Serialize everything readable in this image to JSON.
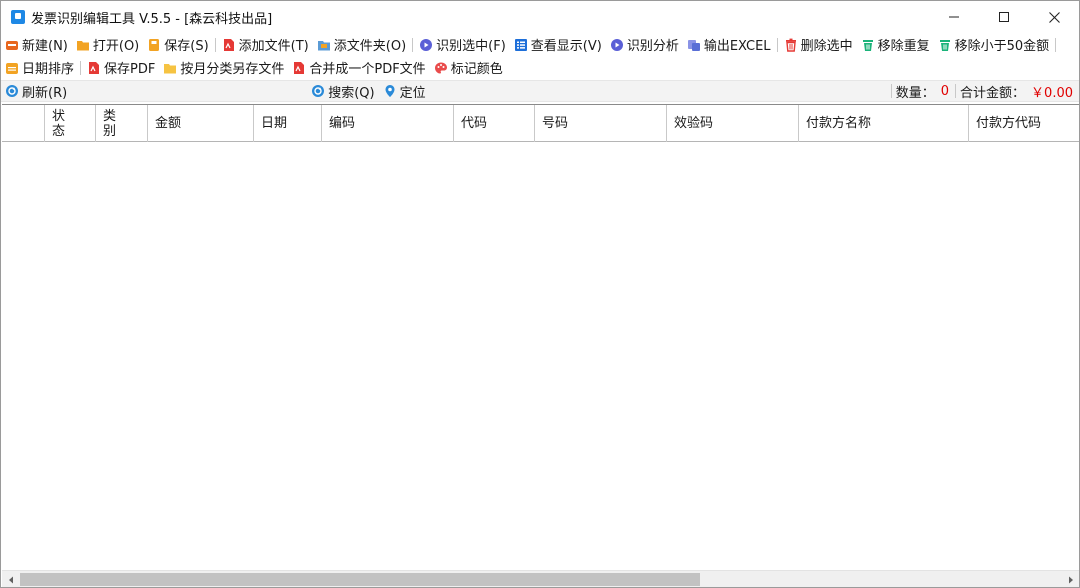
{
  "window": {
    "title": "发票识别编辑工具 V.5.5 - [森云科技出品]"
  },
  "toolbar_main": {
    "items": [
      {
        "label": "新建(N)",
        "icon": "new-icon",
        "color": "#e8671e"
      },
      {
        "label": "打开(O)",
        "icon": "folder-open-icon",
        "color": "#f2a323"
      },
      {
        "label": "保存(S)",
        "icon": "save-icon",
        "color": "#f2a323"
      },
      {
        "label": "添加文件(T)",
        "icon": "pdf-add-icon",
        "color": "#e53935"
      },
      {
        "label": "添文件夹(O)",
        "icon": "folder-add-icon",
        "color": "#5b9bd5"
      },
      {
        "label": "识别选中(F)",
        "icon": "recognize-icon",
        "color": "#5a5fd6"
      },
      {
        "label": "查看显示(V)",
        "icon": "view-list-icon",
        "color": "#1e6fd9"
      },
      {
        "label": "识别分析",
        "icon": "analyze-icon",
        "color": "#5a5fd6"
      },
      {
        "label": "输出EXCEL",
        "icon": "excel-export-icon",
        "color": "#5a6fd6"
      },
      {
        "label": "删除选中",
        "icon": "trash-icon",
        "color": "#e53935"
      },
      {
        "label": "移除重复",
        "icon": "remove-duplicate-icon",
        "color": "#1bb37a"
      },
      {
        "label": "移除小于50金额",
        "icon": "remove-small-icon",
        "color": "#1bb37a"
      }
    ]
  },
  "toolbar_second": {
    "items": [
      {
        "label": "日期排序",
        "icon": "date-sort-icon",
        "color": "#f2a323"
      },
      {
        "label": "保存PDF",
        "icon": "pdf-save-icon",
        "color": "#e53935"
      },
      {
        "label": "按月分类另存文件",
        "icon": "folder-month-icon",
        "color": "#f6c342"
      },
      {
        "label": "合并成一个PDF文件",
        "icon": "pdf-merge-icon",
        "color": "#e53935"
      },
      {
        "label": "标记颜色",
        "icon": "palette-icon",
        "color": "#e94b4b"
      }
    ]
  },
  "toolbar_third": {
    "refresh_label": "刷新(R)",
    "search_label": "搜索(Q)",
    "locate_label": "定位",
    "count_label": "数量：",
    "count_value": "0",
    "total_label": "合计金额：",
    "total_value": "￥0.00",
    "accent_color": "#e00000"
  },
  "table": {
    "columns": [
      "",
      "状态",
      "类别",
      "金额",
      "日期",
      "编码",
      "代码",
      "号码",
      "效验码",
      "付款方名称",
      "付款方代码"
    ],
    "rows": []
  }
}
